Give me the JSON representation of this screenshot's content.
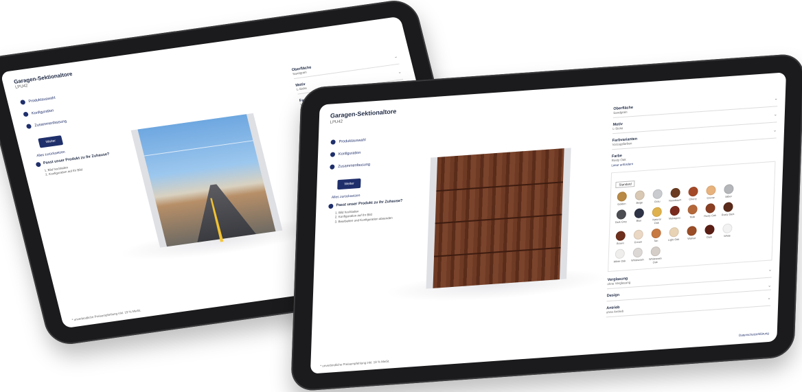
{
  "app": {
    "title": "Garagen-Sektionaltore",
    "subtitle": "LPU42"
  },
  "steps": [
    {
      "label": "Produktauswahl"
    },
    {
      "label": "Konfiguration"
    },
    {
      "label": "Zusammenfassung"
    }
  ],
  "next_button": "Weiter",
  "share_link": "Alles zurücksetzen",
  "help": {
    "title": "Passt unser Produkt zu Ihr Zuhause?",
    "items": [
      "1. Bild hochladen",
      "2. Konfiguration auf Ihr Bild",
      "3. Bearbeiten und Konfiguration absenden"
    ]
  },
  "fields": {
    "surface": {
      "label": "Oberfläche",
      "value": "Sandgrain"
    },
    "pattern": {
      "label": "Motiv",
      "value": "L-Sicke"
    },
    "color_group": {
      "label": "Farbvarianten",
      "value": "Vorzugsfarben"
    },
    "color": {
      "label": "Farbe",
      "value": "Rosty Oak"
    },
    "color_link": "Lasur anfordern",
    "glazing": {
      "label": "Verglasung",
      "value": "ohne Verglasung"
    },
    "handle": {
      "label": "Design",
      "value": ""
    },
    "drive": {
      "label": "Antrieb",
      "value": "ohne Antrieb"
    }
  },
  "swatch_tag": "Standard",
  "swatches": [
    {
      "name": "Golden",
      "color": "#b98a45"
    },
    {
      "name": "Beige",
      "color": "#d8c8b4"
    },
    {
      "name": "Grau",
      "color": "#c9cbcf"
    },
    {
      "name": "Nussbaum",
      "color": "#6b3c22"
    },
    {
      "name": "Cherry",
      "color": "#a54a28"
    },
    {
      "name": "Creme",
      "color": "#e8b27d"
    },
    {
      "name": "Silber",
      "color": "#b4b6ba"
    },
    {
      "name": "",
      "color": ""
    },
    {
      "name": "Dark Grey",
      "color": "#4b4d52"
    },
    {
      "name": "Blue",
      "color": "#2e3346"
    },
    {
      "name": "Natural Oak",
      "color": "#e0b24d"
    },
    {
      "name": "Mahagoni",
      "color": "#7a2a1c"
    },
    {
      "name": "Teak",
      "color": "#b4683a"
    },
    {
      "name": "Rusty Oak",
      "color": "#8a3e22"
    },
    {
      "name": "Rusty Dark",
      "color": "#5a2a1a"
    },
    {
      "name": "",
      "color": ""
    },
    {
      "name": "Brown",
      "color": "#6e2f1d"
    },
    {
      "name": "Cream",
      "color": "#ead7c4"
    },
    {
      "name": "Tan",
      "color": "#c77a44"
    },
    {
      "name": "Light Oak",
      "color": "#e8d3b5"
    },
    {
      "name": "Walnut",
      "color": "#9a4d26"
    },
    {
      "name": "Dark",
      "color": "#5a1e14"
    },
    {
      "name": "White",
      "color": "#f2f2f2"
    },
    {
      "name": "",
      "color": ""
    },
    {
      "name": "White Oak",
      "color": "#efeeec"
    },
    {
      "name": "Whitewash",
      "color": "#dcd8d5"
    },
    {
      "name": "Whitewash Oak",
      "color": "#d4cdc8"
    }
  ],
  "footer": "* unverbindliche Preisempfehlung inkl. 19 % MwSt.",
  "footer_link": "Datenschutzerklärung"
}
